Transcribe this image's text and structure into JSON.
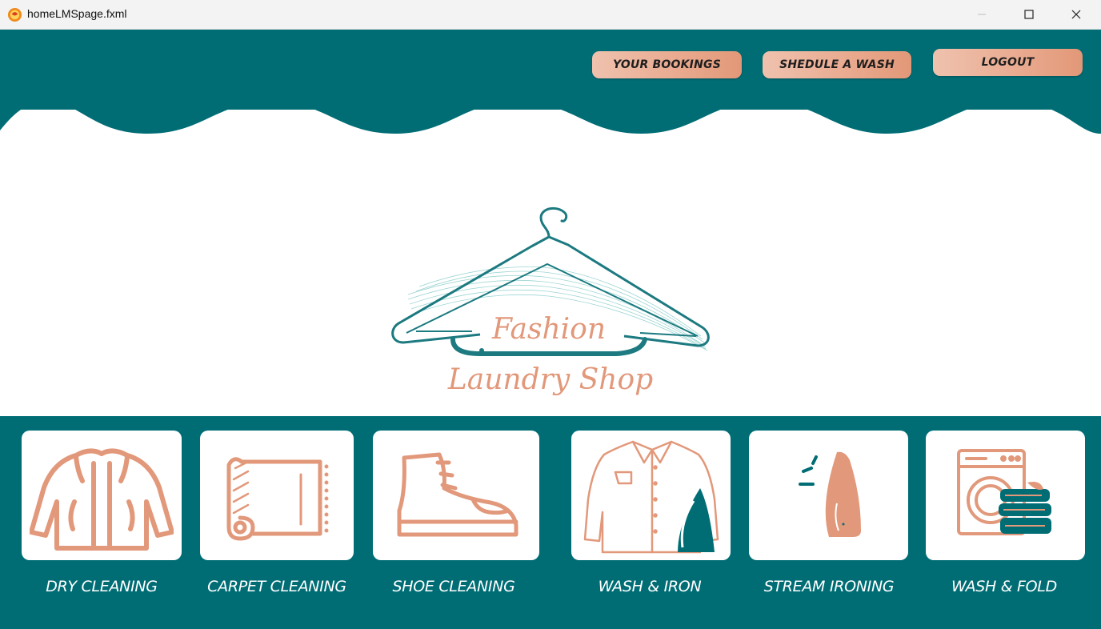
{
  "window": {
    "title": "homeLMSpage.fxml",
    "icons": [
      "app-icon",
      "minimize-icon",
      "maximize-icon",
      "close-icon"
    ]
  },
  "nav": {
    "bookings_label": "YOUR BOOKINGS",
    "schedule_label": "SHEDULE A WASH",
    "logout_label": "LOGOUT"
  },
  "logo": {
    "line1": "Fashion",
    "line2": "Laundry Shop",
    "icon": "hanger-icon"
  },
  "services": [
    {
      "label": "DRY CLEANING",
      "icon": "jacket-icon"
    },
    {
      "label": "CARPET CLEANING",
      "icon": "carpet-roll-icon"
    },
    {
      "label": "SHOE CLEANING",
      "icon": "boot-icon"
    },
    {
      "label": "WASH & IRON",
      "icon": "shirt-iron-icon"
    },
    {
      "label": "STREAM IRONING",
      "icon": "steam-iron-icon"
    },
    {
      "label": "WASH & FOLD",
      "icon": "washing-machine-icon"
    }
  ],
  "colors": {
    "teal": "#006d75",
    "salmon": "#e2987a",
    "button_gradient_start": "#efc2ae",
    "button_gradient_end": "#e29878",
    "white": "#ffffff"
  }
}
